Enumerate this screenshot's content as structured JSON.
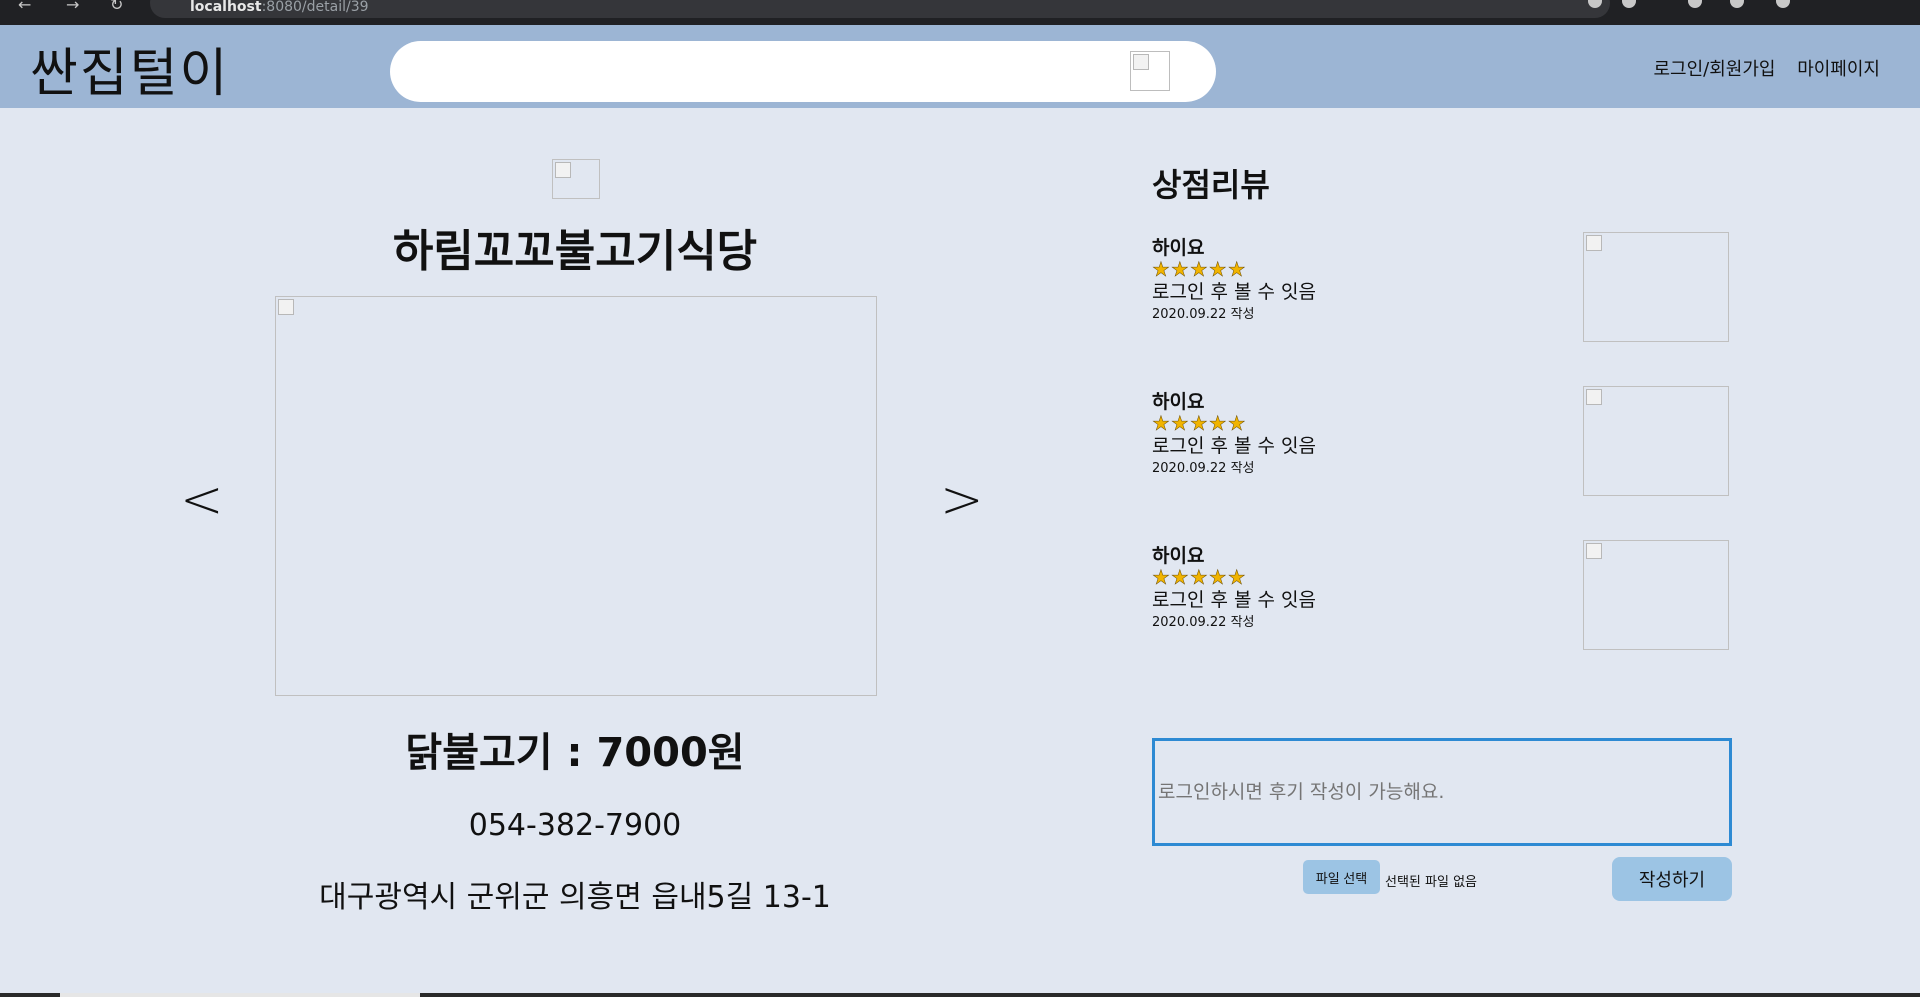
{
  "browser": {
    "url_host": "localhost",
    "url_path": ":8080/detail/39"
  },
  "header": {
    "logo": "싼집털이",
    "search_placeholder": "",
    "nav": [
      "로그인/회원가입",
      "마이페이지"
    ]
  },
  "store": {
    "name": "하림꼬꼬불고기식당",
    "menu_price": "닭불고기 : 7000원",
    "phone": "054-382-7900",
    "address": "대구광역시 군위군 의흥면 읍내5길 13-1",
    "prev_arrow": "<",
    "next_arrow": ">"
  },
  "reviews": {
    "title": "상점리뷰",
    "items": [
      {
        "author": "하이요",
        "stars": "★★★★★",
        "rating": 5,
        "text": "로그인 후 볼 수 잇음",
        "date": "2020.09.22 작성"
      },
      {
        "author": "하이요",
        "stars": "★★★★★",
        "rating": 5,
        "text": "로그인 후 볼 수 잇음",
        "date": "2020.09.22 작성"
      },
      {
        "author": "하이요",
        "stars": "★★★★★",
        "rating": 5,
        "text": "로그인 후 볼 수 잇음",
        "date": "2020.09.22 작성"
      }
    ]
  },
  "review_form": {
    "placeholder": "로그인하시면 후기 작성이 가능해요.",
    "file_button": "파일 선택",
    "file_status": "선택된 파일 없음",
    "submit": "작성하기"
  },
  "colors": {
    "header_bg": "#9cb5d4",
    "page_bg": "#e1e7f1",
    "accent_border": "#2d8ad3",
    "button_bg": "#9cc4e4",
    "star": "#f1b400"
  }
}
